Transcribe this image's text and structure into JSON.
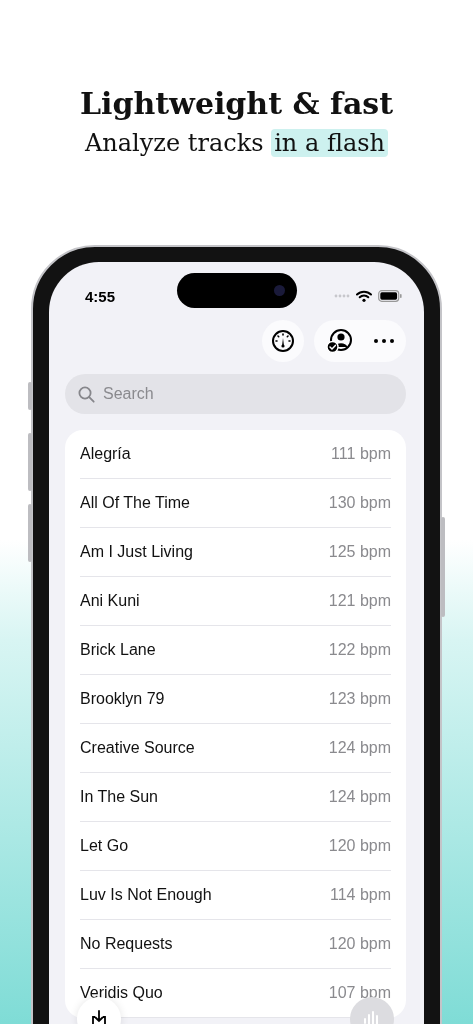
{
  "headline": {
    "title": "Lightweight & fast",
    "subtitle": "Analyze tracks",
    "highlight": "in a flash"
  },
  "status_bar": {
    "time": "4:55"
  },
  "search": {
    "placeholder": "Search"
  },
  "tracks": [
    {
      "name": "Alegría",
      "bpm": "111 bpm"
    },
    {
      "name": "All Of The Time",
      "bpm": "130 bpm"
    },
    {
      "name": "Am I Just Living",
      "bpm": "125 bpm"
    },
    {
      "name": "Ani Kuni",
      "bpm": "121 bpm"
    },
    {
      "name": "Brick Lane",
      "bpm": "122 bpm"
    },
    {
      "name": "Brooklyn 79",
      "bpm": "123 bpm"
    },
    {
      "name": "Creative Source",
      "bpm": "124 bpm"
    },
    {
      "name": "In The Sun",
      "bpm": "124 bpm"
    },
    {
      "name": "Let Go",
      "bpm": "120 bpm"
    },
    {
      "name": "Luv Is Not Enough",
      "bpm": "114 bpm"
    },
    {
      "name": "No Requests",
      "bpm": "120 bpm"
    },
    {
      "name": "Veridis Quo",
      "bpm": "107 bpm"
    }
  ]
}
